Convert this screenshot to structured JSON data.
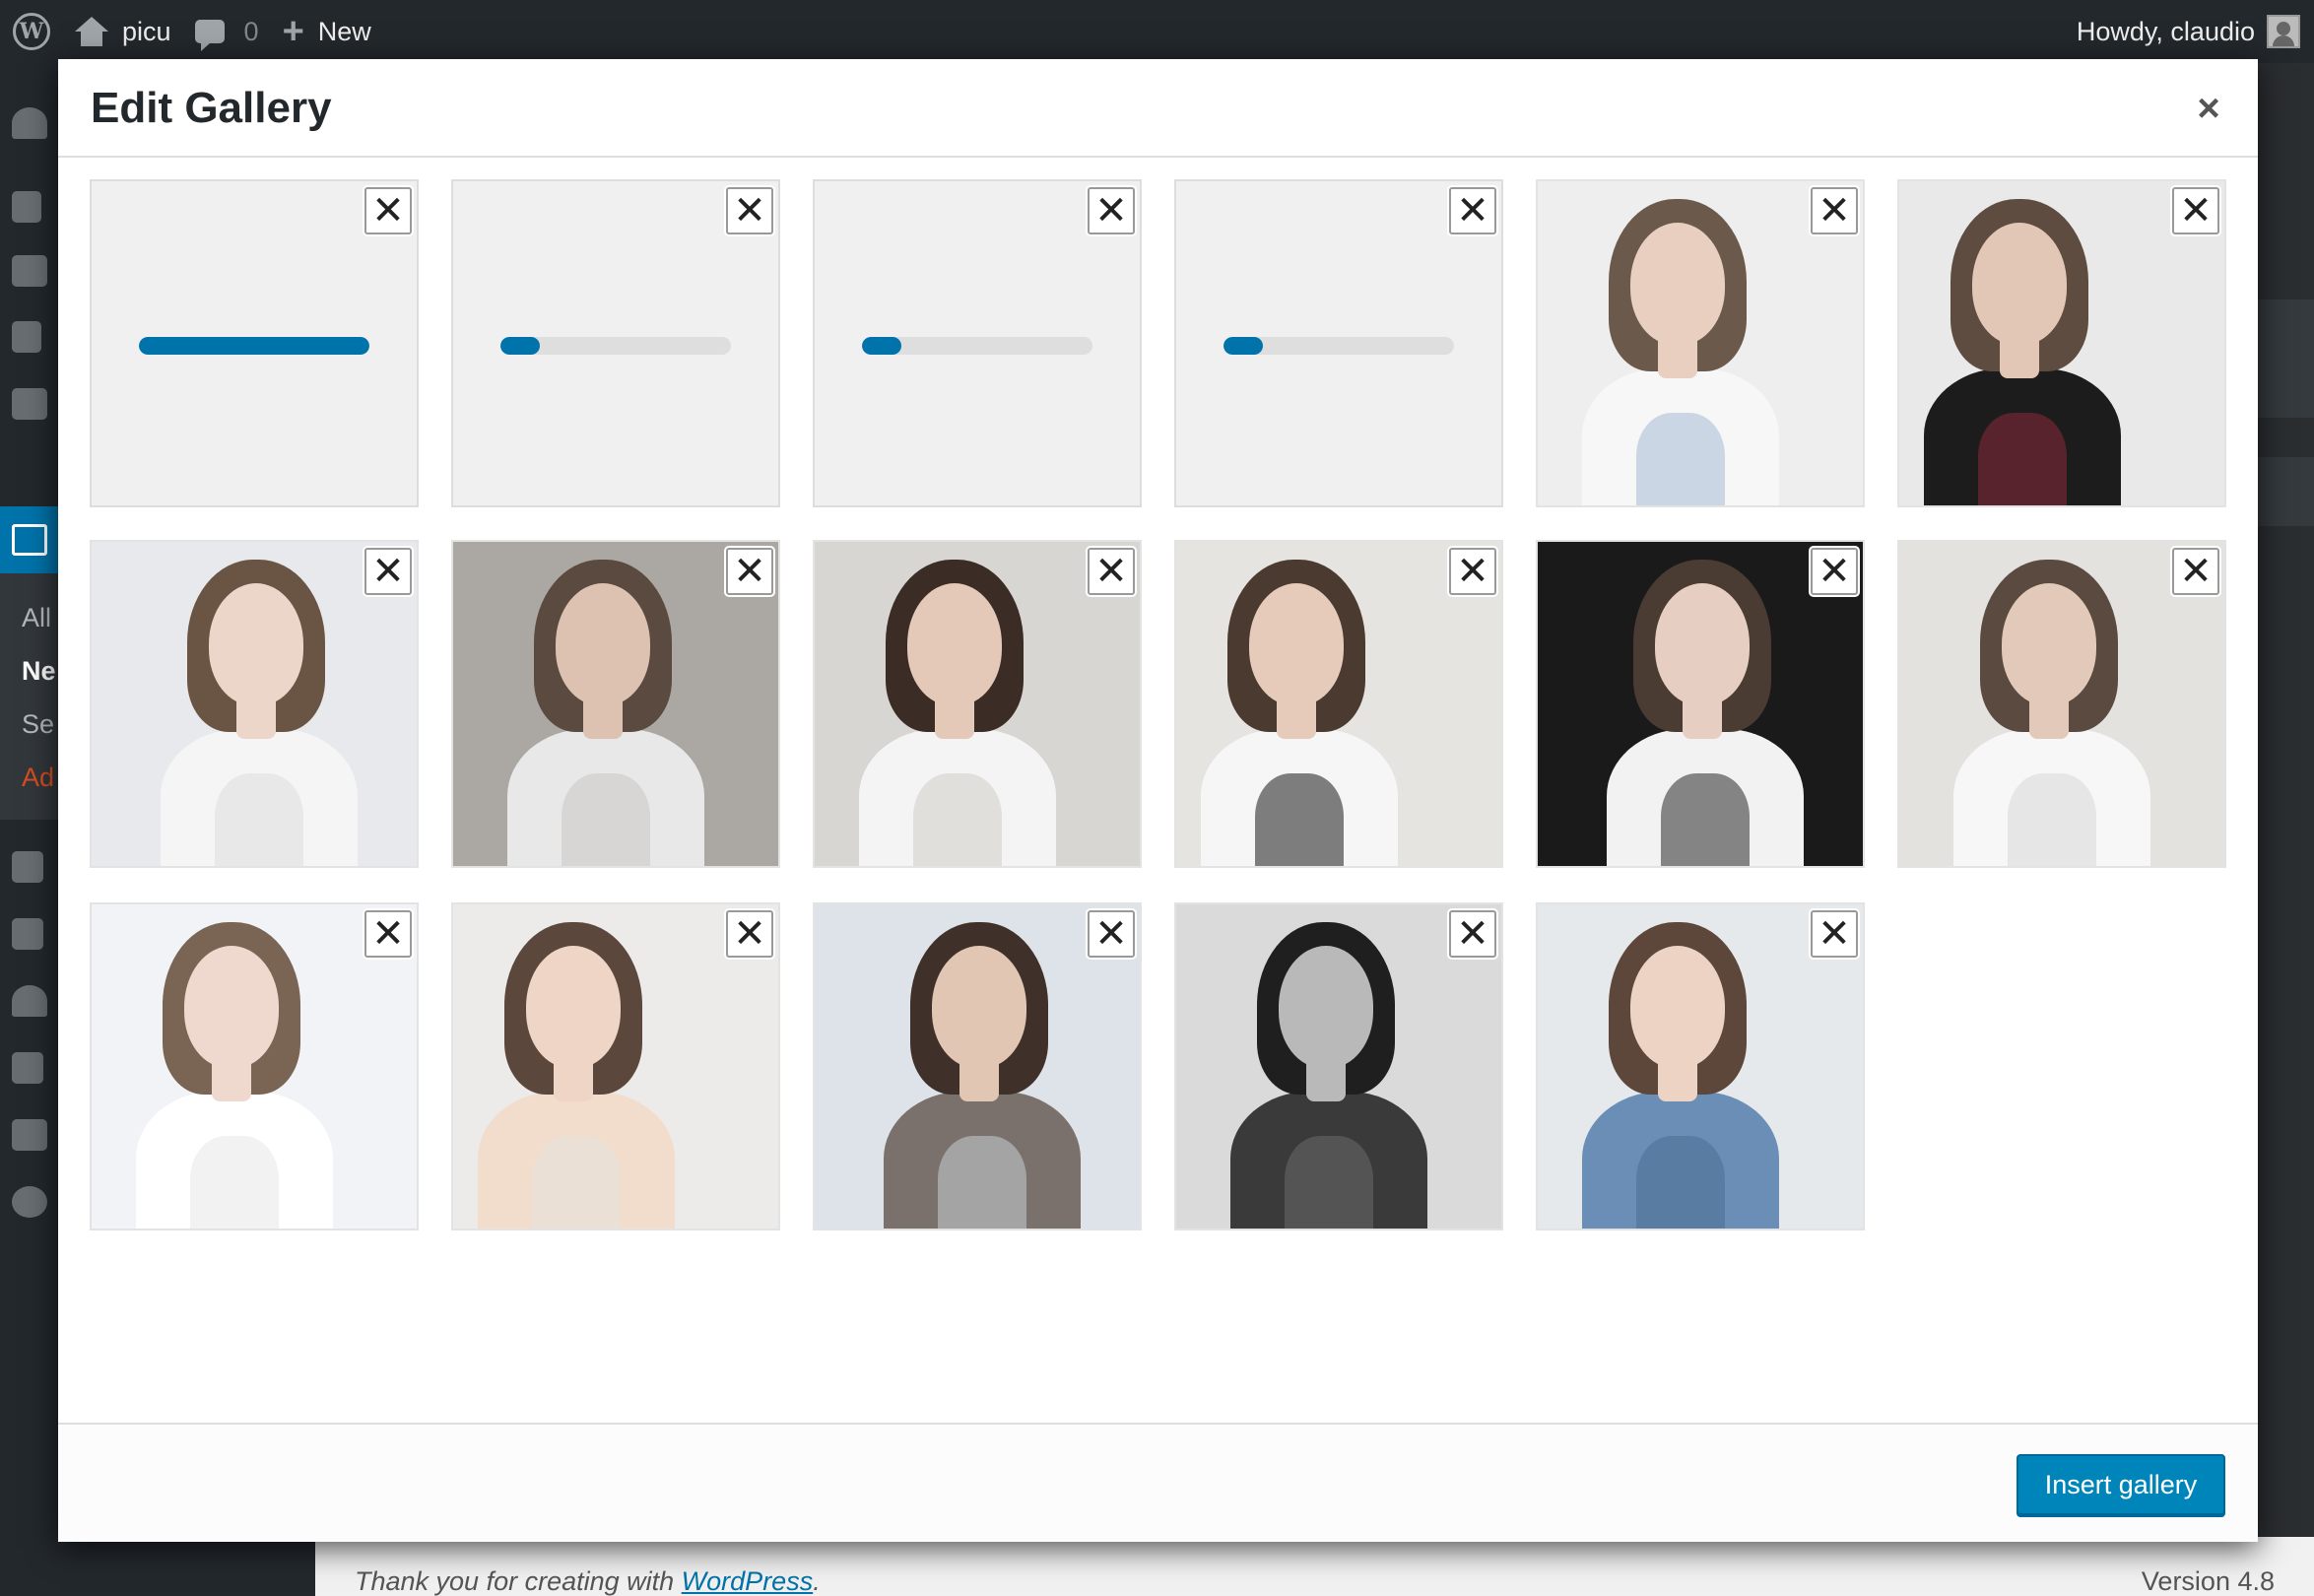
{
  "adminbar": {
    "site_name": "picu",
    "comments_count": "0",
    "new_label": "New",
    "greeting": "Howdy, claudio"
  },
  "sidemenu": {
    "sub_items": [
      "All",
      "Ne",
      "Se",
      "Ad"
    ]
  },
  "footer": {
    "thanks_text": "Thank you for creating with ",
    "wordpress_link": "WordPress",
    "thanks_end": ".",
    "version": "Version 4.8"
  },
  "modal": {
    "title": "Edit Gallery",
    "close_glyph": "×",
    "remove_glyph": "✕",
    "insert_button": "Insert gallery"
  },
  "tiles": [
    {
      "kind": "upload",
      "progress": 1.0
    },
    {
      "kind": "upload",
      "progress": 0.17
    },
    {
      "kind": "upload",
      "progress": 0.17
    },
    {
      "kind": "upload",
      "progress": 0.17
    },
    {
      "kind": "photo",
      "bg": "#eeeeee",
      "hair": "#6b5a4c",
      "skin": "#e8cfc0",
      "cloth": "#f7f7f7",
      "extra": "#a8bcd6"
    },
    {
      "kind": "photo",
      "bg": "#e9e9e9",
      "hair": "#5e4c40",
      "skin": "#e3c7b6",
      "cloth": "#1c1c1c",
      "extra": "#8a2a3b"
    },
    {
      "kind": "photo",
      "bg": "#e7e9ec",
      "hair": "#6a5444",
      "skin": "#ecd6ca",
      "cloth": "#f5f5f5",
      "extra": "#dcdcdc"
    },
    {
      "kind": "photo",
      "bg": "#aba7a2",
      "hair": "#5a4a3f",
      "skin": "#ddc2b2",
      "cloth": "#e8e8e8",
      "extra": "#c9c6c2"
    },
    {
      "kind": "photo",
      "bg": "#d8d6d3",
      "hair": "#3b2d26",
      "skin": "#e4c9b8",
      "cloth": "#f4f4f4",
      "extra": "#cfcdc9"
    },
    {
      "kind": "photo",
      "bg": "#e6e4e1",
      "hair": "#4a3a30",
      "skin": "#e6cbbb",
      "cloth": "#f6f6f6",
      "extra": "#1a1a1a"
    },
    {
      "kind": "photo",
      "bg": "#1a1a1a",
      "hair": "#4b3c33",
      "skin": "#e6cfc2",
      "cloth": "#f2f2f2",
      "extra": "#2a2a2a"
    },
    {
      "kind": "photo",
      "bg": "#e4e2df",
      "hair": "#5b4a3f",
      "skin": "#e3c9ba",
      "cloth": "#f7f7f7",
      "extra": "#d8d8d8"
    },
    {
      "kind": "photo",
      "bg": "#f1f3f6",
      "hair": "#7a6454",
      "skin": "#efd9ce",
      "cloth": "#ffffff",
      "extra": "#e8e8e8"
    },
    {
      "kind": "photo",
      "bg": "#ecebea",
      "hair": "#5b473b",
      "skin": "#efd5c6",
      "cloth": "#f2dccb",
      "extra": "#e6e3e0"
    },
    {
      "kind": "photo",
      "bg": "#dde3e8",
      "hair": "#3f3129",
      "skin": "#e2c6b4",
      "cloth": "#7b716c",
      "extra": "#c9ced3"
    },
    {
      "kind": "photo",
      "bg": "#dadada",
      "hair": "#1f1f1f",
      "skin": "#b9b9b9",
      "cloth": "#3a3a3a",
      "extra": "#6a6a6a"
    },
    {
      "kind": "photo",
      "bg": "#e6e9ec",
      "hair": "#5d473a",
      "skin": "#ecd3c4",
      "cloth": "#6a8eb6",
      "extra": "#4a6d93"
    }
  ]
}
